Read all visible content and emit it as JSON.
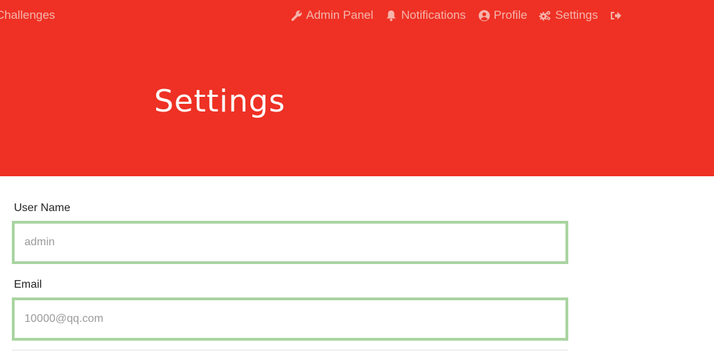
{
  "nav": {
    "left_link": "Challenges",
    "items": [
      {
        "label": "Admin Panel",
        "icon": "wrench-icon"
      },
      {
        "label": "Notifications",
        "icon": "bell-icon"
      },
      {
        "label": "Profile",
        "icon": "user-circle-icon"
      },
      {
        "label": "Settings",
        "icon": "cogs-icon"
      },
      {
        "label": "",
        "icon": "sign-out-icon"
      }
    ]
  },
  "header": {
    "title": "Settings"
  },
  "form": {
    "username_label": "User Name",
    "username_placeholder": "admin",
    "email_label": "Email",
    "email_placeholder": "10000@qq.com"
  },
  "colors": {
    "hero_bg": "#ee3124",
    "nav_text": "#f5b4ac",
    "field_border": "#a9d4a1"
  }
}
